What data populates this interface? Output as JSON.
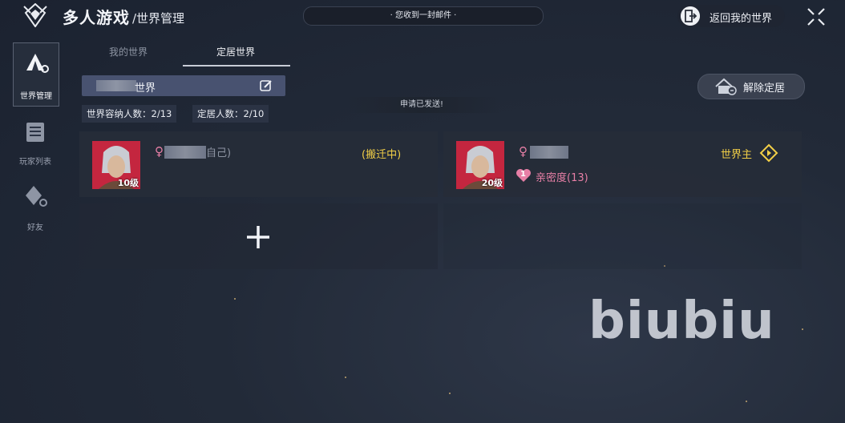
{
  "header": {
    "title": "多人游戏",
    "subtitle": "/世界管理",
    "mail_notice": "· 您收到一封邮件 ·",
    "return_label": "返回我的世界"
  },
  "sidebar": {
    "items": [
      {
        "label": "世界管理",
        "active": true
      },
      {
        "label": "玩家列表",
        "active": false
      },
      {
        "label": "好友",
        "active": false
      }
    ]
  },
  "tabs": [
    {
      "label": "我的世界",
      "active": false
    },
    {
      "label": "定居世界",
      "active": true
    }
  ],
  "world": {
    "name_suffix": "世界",
    "release_label": "解除定居",
    "toast": "申请已发送!",
    "capacity_label": "世界容纳人数：2/13",
    "settled_label": "定居人数：2/10"
  },
  "members": [
    {
      "level": "10级",
      "name_suffix": "自己)",
      "status": "(搬迁中)"
    },
    {
      "level": "20级",
      "role": "世界主",
      "intimacy": "亲密度(13)",
      "intimacy_level": "1"
    }
  ],
  "watermark": "biubiu",
  "colors": {
    "accent_gold": "#f2cf47",
    "female_pink": "#e77fa6",
    "avatar_red": "#c4263f"
  }
}
